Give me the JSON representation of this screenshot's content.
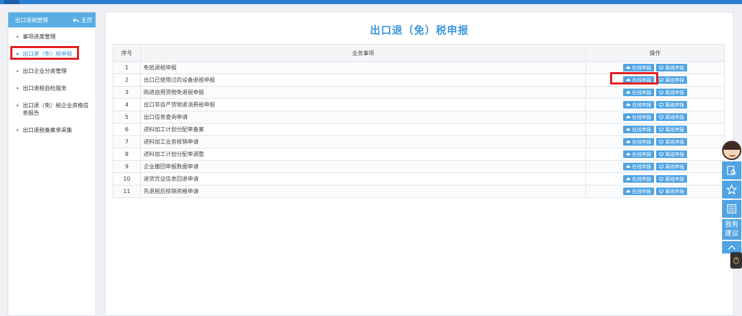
{
  "sidebar": {
    "header_title": "出口退税管理",
    "home_label": "主页",
    "items": [
      {
        "label": "事项进度管理"
      },
      {
        "label": "出口退（免）税申报"
      },
      {
        "label": "出口企业分类管理"
      },
      {
        "label": "出口退税自检服务"
      },
      {
        "label": "出口退（免）税企业资格信息报告"
      },
      {
        "label": "出口退税备案单采集"
      }
    ]
  },
  "main": {
    "title": "出口退（免）税申报",
    "table": {
      "headers": {
        "index": "序号",
        "item": "业务事项",
        "action": "操作"
      },
      "rows": [
        {
          "index": "1",
          "name": "免抵退税申报"
        },
        {
          "index": "2",
          "name": "出口已使用过的设备退税申报"
        },
        {
          "index": "3",
          "name": "购进自用货物免退税申报"
        },
        {
          "index": "4",
          "name": "出口非自产货物退消费税申报"
        },
        {
          "index": "5",
          "name": "出口信息查询申请"
        },
        {
          "index": "6",
          "name": "进料加工计划分配率备案"
        },
        {
          "index": "7",
          "name": "进料加工业务核销申请"
        },
        {
          "index": "8",
          "name": "进料加工计划分配率调整"
        },
        {
          "index": "9",
          "name": "企业撤回申报数据申请"
        },
        {
          "index": "10",
          "name": "退货凭证信息回退申请"
        },
        {
          "index": "11",
          "name": "先退税后核销资格申请"
        }
      ],
      "online_label": "在线申报",
      "offline_label": "离线申报"
    }
  },
  "float_tools": {
    "suggest_label": "我有建议"
  },
  "colors": {
    "accent": "#3a96dd",
    "button": "#4fa3e3",
    "highlight": "#e41d1d"
  },
  "icons": [
    "home-arrow-icon",
    "cloud-upload-icon",
    "monitor-icon",
    "search-doc-icon",
    "star-icon",
    "qr-code-icon",
    "chevron-up-icon",
    "mouse-icon"
  ]
}
